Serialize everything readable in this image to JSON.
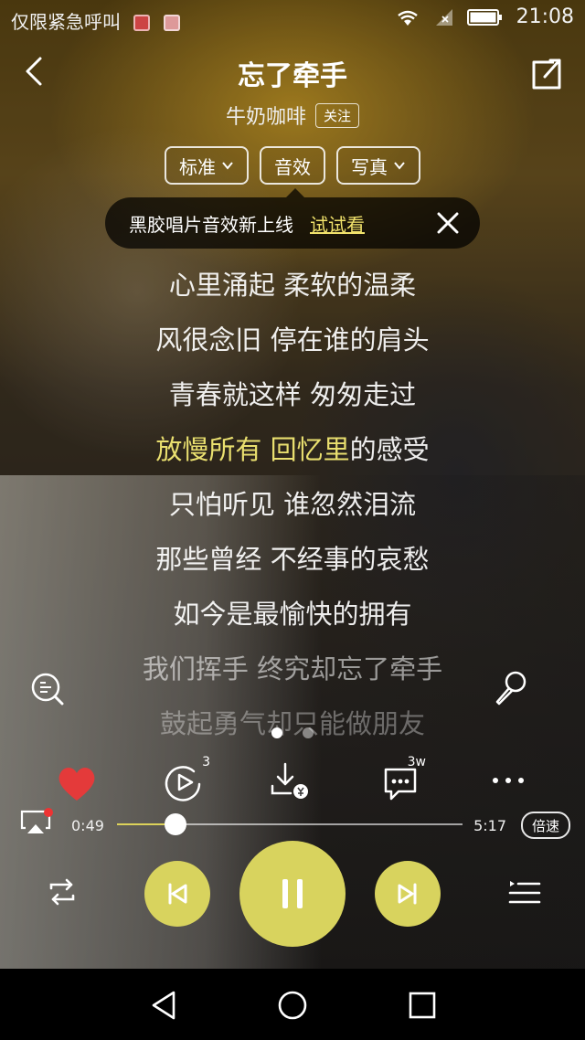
{
  "status_bar": {
    "carrier_text": "仅限紧急呼叫",
    "time": "21:08",
    "icons": [
      "notification-app-icon",
      "notification-app-icon",
      "wifi-icon",
      "signal-icon",
      "battery-icon"
    ]
  },
  "header": {
    "title": "忘了牵手",
    "artist": "牛奶咖啡",
    "follow_label": "关注",
    "back_icon": "chevron-left-icon",
    "share_icon": "share-out-icon"
  },
  "mode_controls": [
    {
      "label": "标准",
      "has_dropdown": true
    },
    {
      "label": "音效",
      "has_dropdown": false
    },
    {
      "label": "写真",
      "has_dropdown": true
    }
  ],
  "tip": {
    "text": "黑胶唱片音效新上线",
    "link": "试试看",
    "close_icon": "close-icon"
  },
  "lyrics": {
    "lines": [
      {
        "text": "心里涌起 柔软的温柔"
      },
      {
        "text": "风很念旧 停在谁的肩头"
      },
      {
        "text": "青春就这样 匆匆走过"
      },
      {
        "highlight": "放慢所有 回忆里",
        "rest": "的感受"
      },
      {
        "text": "只怕听见 谁忽然泪流"
      },
      {
        "text": "那些曾经 不经事的哀愁"
      },
      {
        "text": "如今是最愉快的拥有"
      },
      {
        "text": "我们挥手 终究却忘了牵手"
      },
      {
        "text": "鼓起勇气却只能做朋友"
      }
    ],
    "left_icon": "lyrics-search-icon",
    "right_icon": "microphone-icon"
  },
  "pager": {
    "count": 2,
    "active_index": 0
  },
  "actions": {
    "like_icon": "heart-icon",
    "video_icon": "video-play-icon",
    "video_badge": "3",
    "download_icon": "download-icon",
    "comment_icon": "comment-icon",
    "comment_badge": "3w",
    "more_icon": "more-icon"
  },
  "progress": {
    "current": "0:49",
    "total": "5:17",
    "fraction": 0.17,
    "speed_label": "倍速",
    "airplay_icon": "airplay-icon"
  },
  "playback": {
    "repeat_icon": "repeat-icon",
    "prev_icon": "skip-previous-icon",
    "pause_icon": "pause-icon",
    "next_icon": "skip-next-icon",
    "queue_icon": "queue-list-icon"
  },
  "colors": {
    "accent": "#d8d35e",
    "highlight_lyric": "#e9df6f",
    "heart": "#e43a3a"
  },
  "nav_bar": {
    "back_icon": "triangle-back-icon",
    "home_icon": "circle-home-icon",
    "recent_icon": "square-recent-icon"
  }
}
